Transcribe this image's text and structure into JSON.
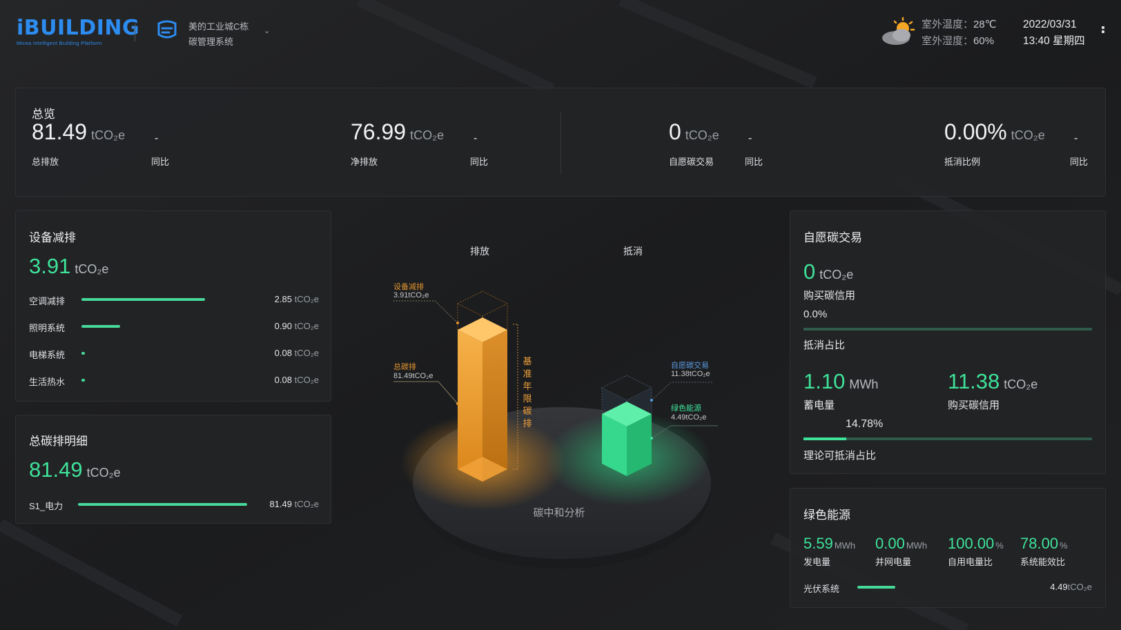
{
  "header": {
    "logo": "iBUILDING",
    "logo_sub": "Micea Intelligent Building Platform",
    "system_line1": "美的工业城C栋",
    "system_line2": "碳管理系统",
    "temp_label": "室外温度：",
    "temp_value": "28℃",
    "humidity_label": "室外湿度：",
    "humidity_value": "60%",
    "date": "2022/03/31",
    "time": "13:40 星期四",
    "icons": [
      "building-logo-icon",
      "weather-sun-cloud-icon",
      "more-icon",
      "chevron-down-icon"
    ]
  },
  "overview": {
    "title": "总览",
    "items": [
      {
        "value": "81.49",
        "unit": "tCO₂e",
        "label": "总排放",
        "compare_label": "同比",
        "compare_value": "-"
      },
      {
        "value": "76.99",
        "unit": "tCO₂e",
        "label": "净排放",
        "compare_label": "同比",
        "compare_value": "-"
      },
      {
        "value": "0",
        "unit": "tCO₂e",
        "label": "自愿碳交易",
        "compare_label": "同比",
        "compare_value": "-"
      },
      {
        "value": "0.00%",
        "unit": "tCO₂e",
        "label": "抵消比例",
        "compare_label": "同比",
        "compare_value": "-"
      }
    ]
  },
  "device_reduction": {
    "title": "设备减排",
    "total": "3.91",
    "unit": "tCO₂e",
    "rows": [
      {
        "name": "空调减排",
        "value": "2.85",
        "unit": "tCO₂e",
        "fraction": 0.73
      },
      {
        "name": "照明系统",
        "value": "0.90",
        "unit": "tCO₂e",
        "fraction": 0.23
      },
      {
        "name": "电梯系统",
        "value": "0.08",
        "unit": "tCO₂e",
        "fraction": 0.02
      },
      {
        "name": "生活热水",
        "value": "0.08",
        "unit": "tCO₂e",
        "fraction": 0.02
      }
    ]
  },
  "total_detail": {
    "title": "总碳排明细",
    "total": "81.49",
    "unit": "tCO₂e",
    "rows": [
      {
        "name": "S1_电力",
        "value": "81.49",
        "unit": "tCO₂e",
        "fraction": 1.0
      }
    ]
  },
  "center": {
    "label_emission": "排放",
    "label_offset": "抵消",
    "device_label": "设备减排",
    "device_value": "3.91tCO₂e",
    "total_label": "总碳排",
    "total_value": "81.49tCO₂e",
    "baseline_label": "基准年限碳排",
    "voluntary_label": "自愿碳交易",
    "voluntary_value": "11.38tCO₂e",
    "green_label": "绿色能源",
    "green_value": "4.49tCO₂e",
    "platform_label": "碳中和分析"
  },
  "voluntary": {
    "title": "自愿碳交易",
    "value": "0",
    "unit": "tCO₂e",
    "value_label": "购买碳信用",
    "percent": "0.0%",
    "percent_fraction": 0.0,
    "offset_label": "抵消占比",
    "storage_value": "1.10",
    "storage_unit": "MWh",
    "storage_label": "蓄电量",
    "credit_value": "11.38",
    "credit_unit": "tCO₂e",
    "credit_label": "购买碳信用",
    "theory_percent": "14.78%",
    "theory_fraction": 0.1478,
    "theory_label": "理论可抵消占比"
  },
  "green_energy": {
    "title": "绿色能源",
    "items": [
      {
        "value": "5.59",
        "unit": "MWh",
        "label": "发电量"
      },
      {
        "value": "0.00",
        "unit": "MWh",
        "label": "并网电量"
      },
      {
        "value": "100.00",
        "unit": "%",
        "label": "自用电量比"
      },
      {
        "value": "78.00",
        "unit": "%",
        "label": "系统能效比"
      }
    ],
    "row": {
      "name": "光伏系统",
      "value": "4.49",
      "unit": "tCO₂e",
      "fraction": 0.13
    }
  }
}
